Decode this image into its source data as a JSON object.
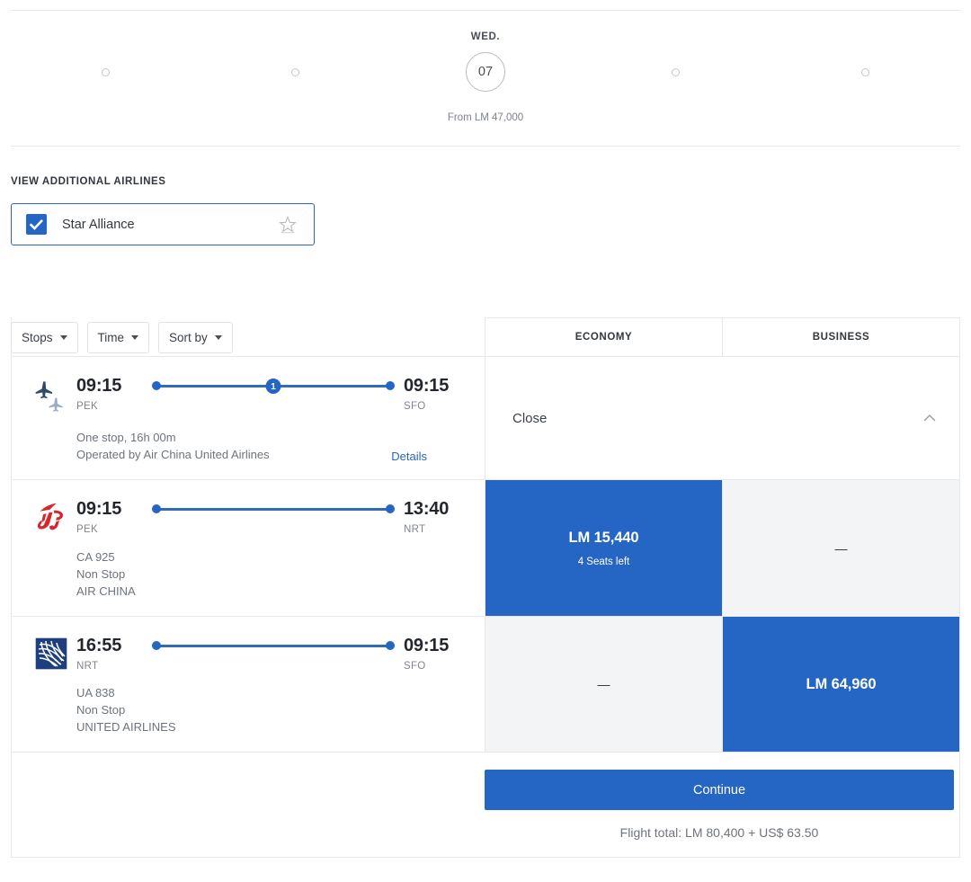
{
  "date_strip": {
    "days": [
      {
        "dow": "",
        "label": "",
        "price": "",
        "selected": false,
        "placeholder": true
      },
      {
        "dow": "",
        "label": "",
        "price": "",
        "selected": false,
        "placeholder": true
      },
      {
        "dow": "WED.",
        "label": "07",
        "price": "From LM 47,000",
        "selected": true,
        "placeholder": false
      },
      {
        "dow": "",
        "label": "",
        "price": "",
        "selected": false,
        "placeholder": true
      },
      {
        "dow": "",
        "label": "",
        "price": "",
        "selected": false,
        "placeholder": true
      }
    ]
  },
  "additional_airlines": {
    "title": "VIEW ADDITIONAL AIRLINES",
    "option_label": "Star Alliance",
    "checked": true,
    "logo_name": "star-alliance-logo"
  },
  "filters": [
    {
      "label": "Stops",
      "name": "stops-filter"
    },
    {
      "label": "Time",
      "name": "time-filter"
    },
    {
      "label": "Sort by",
      "name": "sort-by-filter"
    }
  ],
  "columns": [
    {
      "label": "ECONOMY"
    },
    {
      "label": "BUSINESS"
    }
  ],
  "itinerary_summary": {
    "airline_mark": "two-planes-icon",
    "depart_time": "09:15",
    "depart_code": "PEK",
    "arrive_time": "09:15",
    "arrive_code": "SFO",
    "stops_badge": "1",
    "duration_line": "One stop, 16h 00m",
    "operator_line": "Operated by Air China United Airlines",
    "details_label": "Details",
    "close_label": "Close"
  },
  "segments": [
    {
      "airline_mark": "air-china-logo",
      "depart_time": "09:15",
      "depart_code": "PEK",
      "arrive_time": "13:40",
      "arrive_code": "NRT",
      "flight_number": "CA 925",
      "stops_text": "Non Stop",
      "airline_name": "AIR CHINA",
      "fares": [
        {
          "cabin": "ECONOMY",
          "price": "LM 15,440",
          "seats": "4 Seats left",
          "selected": true,
          "available": true
        },
        {
          "cabin": "BUSINESS",
          "price": "—",
          "seats": "",
          "selected": false,
          "available": false
        }
      ]
    },
    {
      "airline_mark": "united-airlines-logo",
      "depart_time": "16:55",
      "depart_code": "NRT",
      "arrive_time": "09:15",
      "arrive_code": "SFO",
      "flight_number": "UA 838",
      "stops_text": "Non Stop",
      "airline_name": "UNITED AIRLINES",
      "fares": [
        {
          "cabin": "ECONOMY",
          "price": "—",
          "seats": "",
          "selected": false,
          "available": false
        },
        {
          "cabin": "BUSINESS",
          "price": "LM 64,960",
          "seats": "",
          "selected": true,
          "available": true
        }
      ]
    }
  ],
  "footer": {
    "continue_label": "Continue",
    "flight_total": "Flight total: LM 80,400 + US$ 63.50"
  },
  "colors": {
    "accent_blue": "#2566c4",
    "line_blue": "#2f6db5",
    "empty_grey": "#f2f4f6",
    "border": "#e6e8eb",
    "air_china_red": "#d8262c",
    "united_navy": "#1d3f7d"
  }
}
